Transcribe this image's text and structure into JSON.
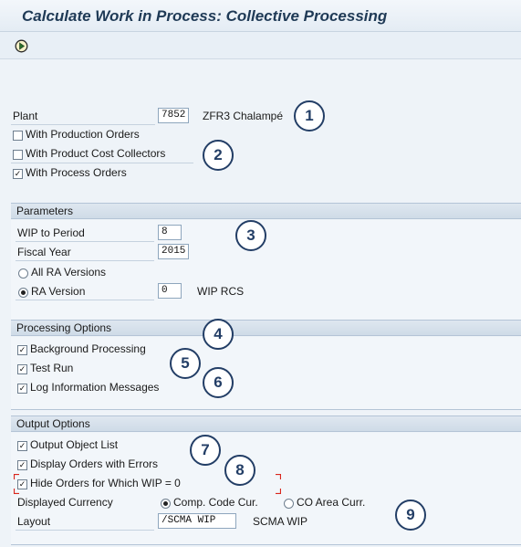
{
  "window": {
    "title": "Calculate Work in Process: Collective Processing"
  },
  "toolbar": {
    "execute_icon": "execute-icon"
  },
  "selection": {
    "plant_label": "Plant",
    "plant_value": "7852",
    "plant_desc": "ZFR3 Chalampé",
    "with_production_orders": "With Production Orders",
    "with_product_cost_collectors": "With Product Cost Collectors",
    "with_process_orders": "With Process Orders"
  },
  "parameters": {
    "header": "Parameters",
    "wip_to_period_label": "WIP to Period",
    "wip_to_period_value": "8",
    "fiscal_year_label": "Fiscal Year",
    "fiscal_year_value": "2015",
    "all_ra_versions": "All RA Versions",
    "ra_version_label": "RA Version",
    "ra_version_value": "0",
    "ra_version_desc": "WIP RCS"
  },
  "processing": {
    "header": "Processing Options",
    "background_processing": "Background Processing",
    "test_run": "Test Run",
    "log_information_messages": "Log Information Messages"
  },
  "output": {
    "header": "Output Options",
    "output_object_list": "Output Object List",
    "display_orders_with_errors": "Display Orders with Errors",
    "hide_orders_wip_zero": "Hide Orders for Which WIP = 0",
    "displayed_currency_label": "Displayed Currency",
    "comp_code_cur": "Comp. Code Cur.",
    "co_area_curr": "CO Area Curr.",
    "layout_label": "Layout",
    "layout_value": "/SCMA WIP",
    "layout_desc": "SCMA WIP"
  },
  "checks": {
    "with_production_orders": false,
    "with_product_cost_collectors": false,
    "with_process_orders": true,
    "background_processing": true,
    "test_run": true,
    "log_information_messages": true,
    "output_object_list": true,
    "display_orders_with_errors": true,
    "hide_orders_wip_zero": true
  },
  "radios": {
    "all_ra_versions": false,
    "ra_version": true,
    "comp_code_cur": true,
    "co_area_curr": false
  },
  "callouts": [
    "1",
    "2",
    "3",
    "4",
    "5",
    "6",
    "7",
    "8",
    "9"
  ],
  "colors": {
    "callout": "#233e66",
    "title": "#1f3a56",
    "focus": "#d9261c"
  }
}
